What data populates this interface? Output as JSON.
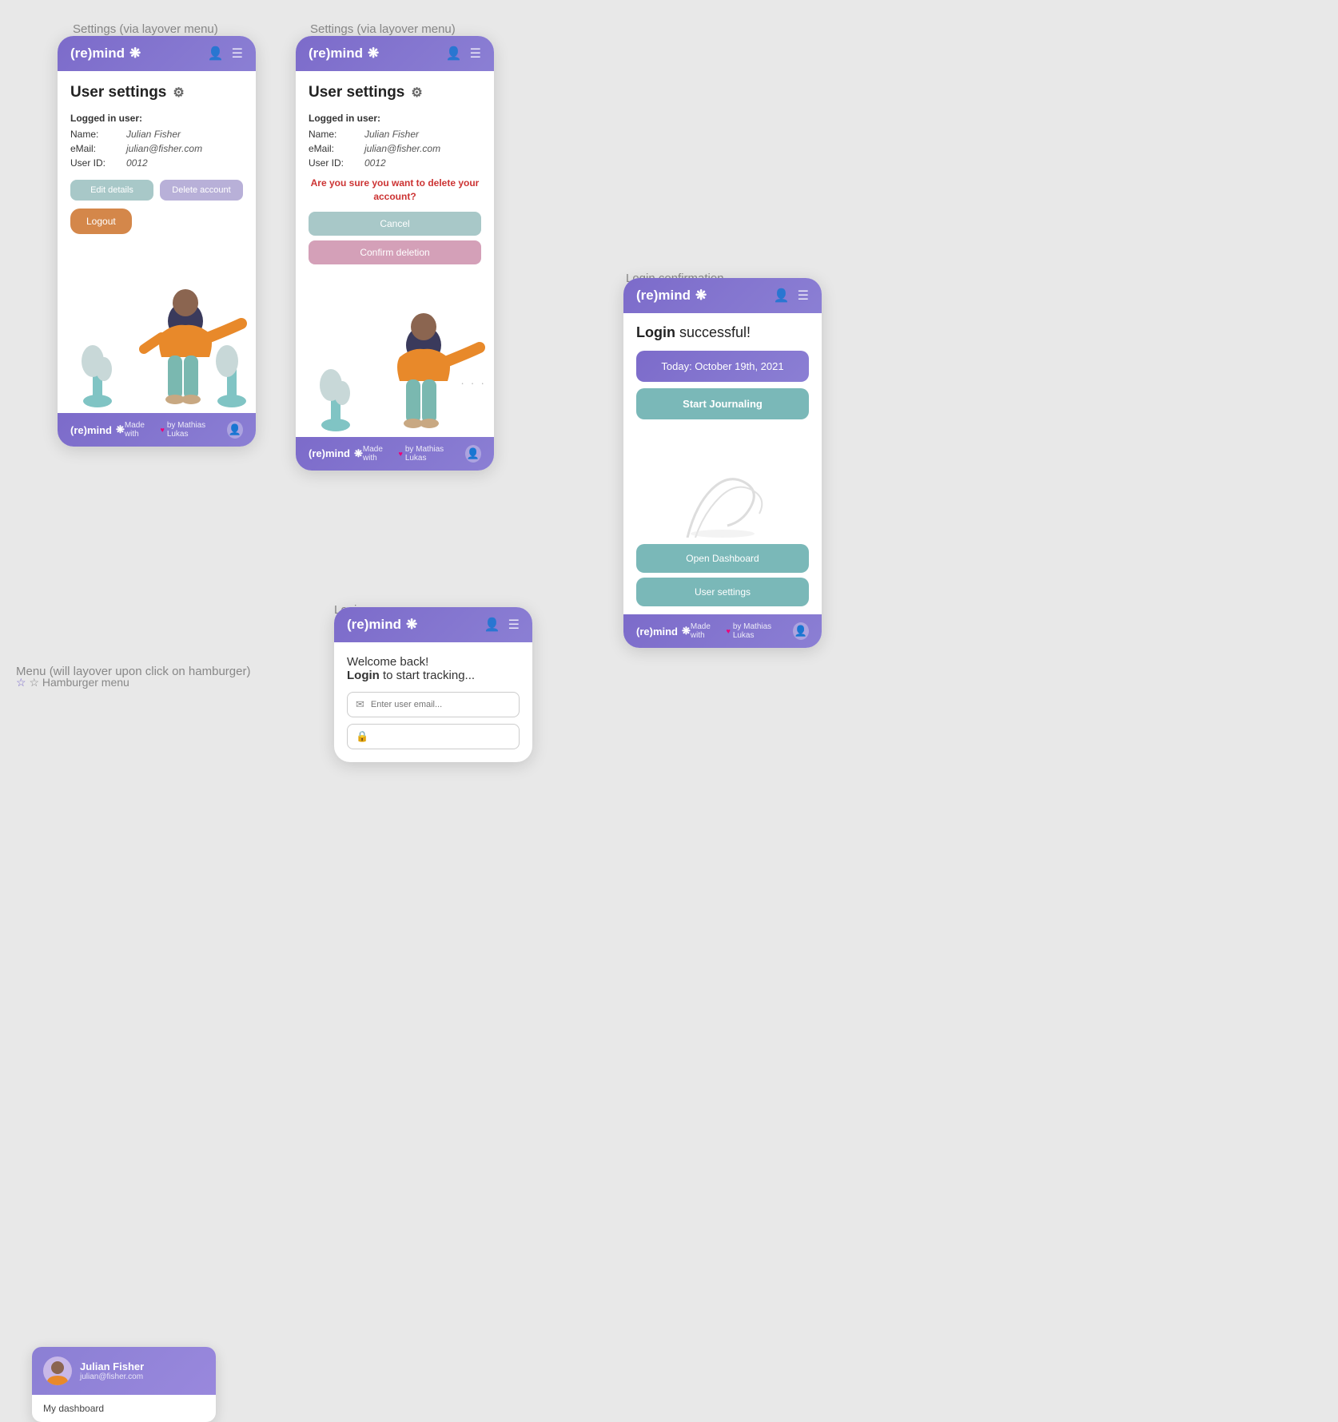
{
  "labels": {
    "settings1": "Settings (via layover menu)",
    "settings2": "Settings (via layover menu)",
    "login_confirm": "Login confirmation",
    "login_page": "Login page",
    "hamburger": "Menu (will layover upon click on hamburger)",
    "hamburger_title": "☆ Hamburger menu"
  },
  "app": {
    "name": "(re)mind",
    "logo_icon": "❋"
  },
  "settings": {
    "title": "User settings",
    "section_label": "Logged in user:",
    "name_key": "Name:",
    "name_value": "Julian Fisher",
    "email_key": "eMail:",
    "email_value": "julian@fisher.com",
    "userid_key": "User ID:",
    "userid_value": "0012",
    "btn_edit": "Edit details",
    "btn_delete": "Delete account",
    "btn_logout": "Logout",
    "delete_question": "Are you sure you want to delete your account?",
    "btn_cancel": "Cancel",
    "btn_confirm": "Confirm deletion"
  },
  "login_confirm": {
    "success_text": "Login",
    "success_text2": " successful!",
    "today_btn": "Today: October 19th, 2021",
    "start_journaling": "Start Journaling",
    "open_dashboard": "Open Dashboard",
    "user_settings": "User settings"
  },
  "login_page": {
    "welcome": "Welcome back!",
    "login_prompt": "Login",
    "login_prompt2": " to start tracking...",
    "email_placeholder": "Enter user email...",
    "password_placeholder": ""
  },
  "menu": {
    "user_name": "Julian Fisher",
    "user_email": "julian@fisher.com",
    "item1": "My dashboard"
  },
  "footer": {
    "made_with": "Made with",
    "by": "by Mathias Lukas"
  }
}
